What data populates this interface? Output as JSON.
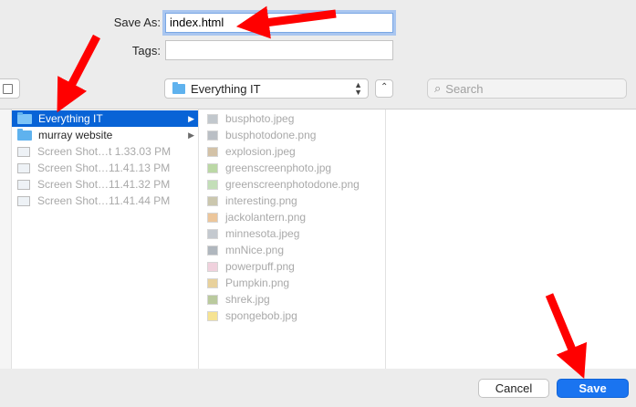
{
  "save_as": {
    "label": "Save As:",
    "value": "index.html"
  },
  "tags": {
    "label": "Tags:",
    "value": ""
  },
  "location": {
    "selected": "Everything IT"
  },
  "search": {
    "placeholder": "Search"
  },
  "column1": [
    {
      "name": "Everything IT",
      "type": "folder",
      "selected": true,
      "has_children": true
    },
    {
      "name": "murray website",
      "type": "folder",
      "selected": false,
      "has_children": true
    },
    {
      "name": "Screen Shot…t 1.33.03 PM",
      "type": "image",
      "dim": true
    },
    {
      "name": "Screen Shot…11.41.13 PM",
      "type": "image",
      "dim": true
    },
    {
      "name": "Screen Shot…11.41.32 PM",
      "type": "image",
      "dim": true
    },
    {
      "name": "Screen Shot…11.41.44 PM",
      "type": "image",
      "dim": true
    }
  ],
  "column2": [
    "busphoto.jpeg",
    "busphotodone.png",
    "explosion.jpeg",
    "greenscreenphoto.jpg",
    "greenscreenphotodone.png",
    "interesting.png",
    "jackolantern.png",
    "minnesota.jpeg",
    "mnNice.png",
    "powerpuff.png",
    "Pumpkin.png",
    "shrek.jpg",
    "spongebob.jpg"
  ],
  "buttons": {
    "cancel": "Cancel",
    "save": "Save"
  },
  "colors": {
    "selection": "#0863d6",
    "save_button": "#1a74f0",
    "annotation_arrow": "#ff0000"
  }
}
